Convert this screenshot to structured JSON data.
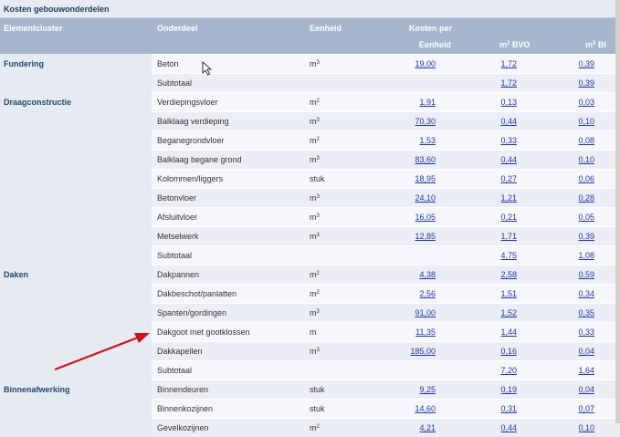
{
  "title": "Kosten gebouwonderdelen",
  "columns": {
    "cluster": "Elementcluster",
    "part": "Onderdeel",
    "unit": "Eenheid",
    "cost_line1": "Kosten per",
    "cost_line2": "Eenheid",
    "bvo_base": "m",
    "bvo_sup": "2",
    "bvo_suffix": " BVO",
    "bi_base": "m",
    "bi_sup": "3",
    "bi_suffix": " BI"
  },
  "rows": [
    {
      "cluster": "Fundering",
      "part": "Beton",
      "unit_base": "m",
      "unit_sup": "3",
      "cost": "19,00",
      "bvo": "1,72",
      "bi": "0,39"
    },
    {
      "cluster": "",
      "part": "Subtotaal",
      "unit_base": "",
      "unit_sup": "",
      "cost": "",
      "bvo": "1,72",
      "bi": "0,39"
    },
    {
      "cluster": "Draagconstructie",
      "part": "Verdiepingsvloer",
      "unit_base": "m",
      "unit_sup": "2",
      "cost": "1,91",
      "bvo": "0,13",
      "bi": "0,03"
    },
    {
      "cluster": "",
      "part": "Balklaag verdieping",
      "unit_base": "m",
      "unit_sup": "3",
      "cost": "70,30",
      "bvo": "0,44",
      "bi": "0,10"
    },
    {
      "cluster": "",
      "part": "Beganegrondvloer",
      "unit_base": "m",
      "unit_sup": "2",
      "cost": "1,53",
      "bvo": "0,33",
      "bi": "0,08"
    },
    {
      "cluster": "",
      "part": "Balklaag begane grond",
      "unit_base": "m",
      "unit_sup": "3",
      "cost": "83,60",
      "bvo": "0,44",
      "bi": "0,10"
    },
    {
      "cluster": "",
      "part": "Kolommen/liggers",
      "unit_base": "stuk",
      "unit_sup": "",
      "cost": "18,95",
      "bvo": "0,27",
      "bi": "0,06"
    },
    {
      "cluster": "",
      "part": "Betonvloer",
      "unit_base": "m",
      "unit_sup": "3",
      "cost": "24,10",
      "bvo": "1,21",
      "bi": "0,28"
    },
    {
      "cluster": "",
      "part": "Afsluitvloer",
      "unit_base": "m",
      "unit_sup": "3",
      "cost": "16,05",
      "bvo": "0,21",
      "bi": "0,05"
    },
    {
      "cluster": "",
      "part": "Metselwerk",
      "unit_base": "m",
      "unit_sup": "3",
      "cost": "12,85",
      "bvo": "1,71",
      "bi": "0,39"
    },
    {
      "cluster": "",
      "part": "Subtotaal",
      "unit_base": "",
      "unit_sup": "",
      "cost": "",
      "bvo": "4,75",
      "bi": "1,08"
    },
    {
      "cluster": "Daken",
      "part": "Dakpannen",
      "unit_base": "m",
      "unit_sup": "2",
      "cost": "4,38",
      "bvo": "2,58",
      "bi": "0,59"
    },
    {
      "cluster": "",
      "part": "Dakbeschot/panlatten",
      "unit_base": "m",
      "unit_sup": "2",
      "cost": "2,56",
      "bvo": "1,51",
      "bi": "0,34"
    },
    {
      "cluster": "",
      "part": "Spanten/gordingen",
      "unit_base": "m",
      "unit_sup": "3",
      "cost": "91,00",
      "bvo": "1,52",
      "bi": "0,35"
    },
    {
      "cluster": "",
      "part": "Dakgoot met gootklossen",
      "unit_base": "m",
      "unit_sup": "",
      "cost": "11,35",
      "bvo": "1,44",
      "bi": "0,33"
    },
    {
      "cluster": "",
      "part": "Dakkapellen",
      "unit_base": "m",
      "unit_sup": "3",
      "cost": "185,00",
      "bvo": "0,16",
      "bi": "0,04"
    },
    {
      "cluster": "",
      "part": "Subtotaal",
      "unit_base": "",
      "unit_sup": "",
      "cost": "",
      "bvo": "7,20",
      "bi": "1,64"
    },
    {
      "cluster": "Binnenafwerking",
      "part": "Binnendeuren",
      "unit_base": "stuk",
      "unit_sup": "",
      "cost": "9,25",
      "bvo": "0,19",
      "bi": "0,04"
    },
    {
      "cluster": "",
      "part": "Binnenkozijnen",
      "unit_base": "stuk",
      "unit_sup": "",
      "cost": "14,60",
      "bvo": "0,31",
      "bi": "0,07"
    },
    {
      "cluster": "",
      "part": "Gevelkozijnen",
      "unit_base": "m",
      "unit_sup": "2",
      "cost": "4,21",
      "bvo": "0,44",
      "bi": "0,10"
    }
  ],
  "colors": {
    "header": "#a6b6cd",
    "link": "#1f37b4",
    "cluster_text": "#1d4872",
    "arrow": "#d8101a"
  },
  "overlay_icons": [
    "mouse-cursor-icon",
    "red-arrow-annotation"
  ]
}
